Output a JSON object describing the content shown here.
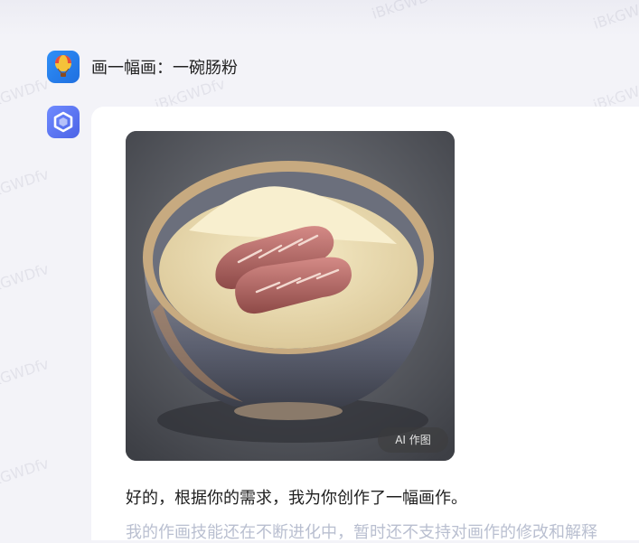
{
  "conversation": {
    "user_message": "画一幅画：一碗肠粉",
    "image_badge": "AI 作图",
    "reply_text": "好的，根据你的需求，我为你创作了一幅画作。",
    "reply_cutoff_text": "我的作画技能还在不断进化中，暂时还不支持对画作的修改和解释"
  },
  "watermark": "iBkGWDfv"
}
